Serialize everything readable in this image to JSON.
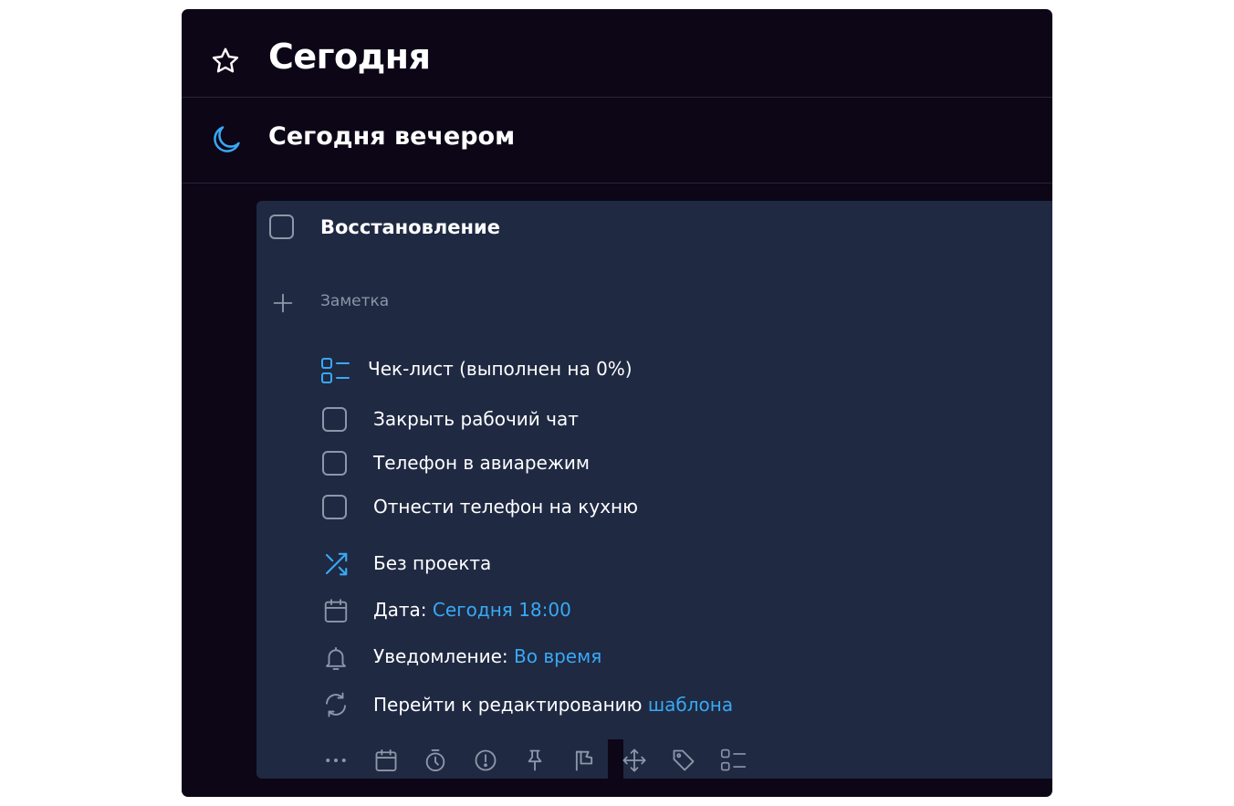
{
  "header": {
    "title": "Сегодня",
    "icon": "star-icon"
  },
  "evening": {
    "title": "Сегодня вечером",
    "icon": "moon-icon"
  },
  "task": {
    "title": "Восстановление",
    "note_placeholder": "Заметка",
    "checklist_header": "Чек-лист (выполнен на 0%)",
    "checklist_progress": 0,
    "checklist": [
      "Закрыть рабочий чат",
      "Телефон в авиарежим",
      "Отнести телефон на кухню"
    ],
    "project": "Без проекта",
    "date_label": "Дата:",
    "date_value": "Сегодня 18:00",
    "notify_label": "Уведомление:",
    "notify_value": "Во время",
    "repeat_label": "Перейти к редактированию",
    "repeat_link": "шаблона"
  },
  "toolbar": [
    "more-icon",
    "calendar-icon",
    "timer-icon",
    "priority-icon",
    "pin-icon",
    "flag-icon",
    "move-icon",
    "tag-icon",
    "checklist-icon"
  ],
  "colors": {
    "background": "#0c0617",
    "card": "#1f2942",
    "accent": "#38a9f4",
    "muted": "#8e96a8"
  }
}
